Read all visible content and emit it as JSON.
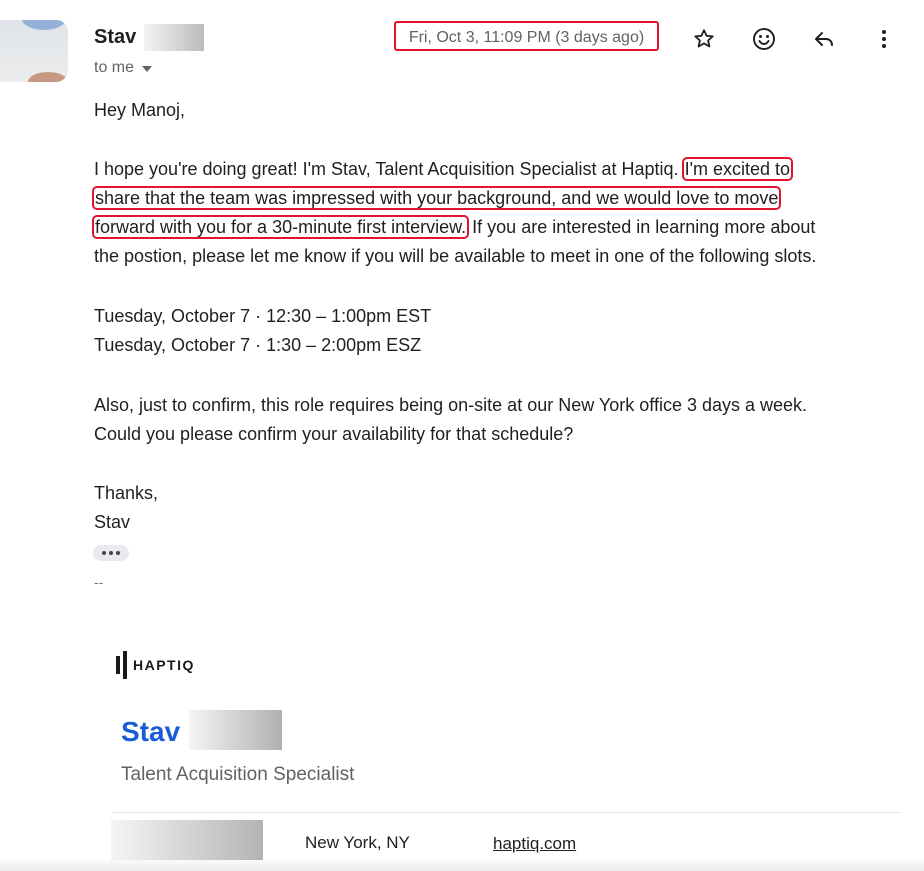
{
  "header": {
    "sender_name": "Stav",
    "recipient_label": "to me",
    "date": "Fri, Oct 3, 11:09 PM (3 days ago)",
    "icons": [
      "star-icon",
      "emoji-icon",
      "reply-icon",
      "more-vert-icon"
    ]
  },
  "email": {
    "greeting": "Hey Manoj,",
    "para1_line1_pre": "I hope you're doing great! I'm Stav, Talent Acquisition Specialist at Haptiq.",
    "para1_line1_hl": "I'm excited to",
    "para1_line2_hl": "share that the team was impressed with your background, and we would love to move",
    "para1_line3_hl": "forward with you for a 30-minute first interview.",
    "para1_line3_post": "If you are interested in learning more about",
    "para1_line4": "the postion, please let me know if you will be available to meet in one of the following slots.",
    "slot1": "Tuesday, October 7 · 12:30 – 1:00pm EST",
    "slot2": "Tuesday, October 7 · 1:30 – 2:00pm ESZ",
    "para3_line1": "Also, just to confirm, this role requires being on-site at our New York office 3 days a week.",
    "para3_line2": "Could you please confirm your availability for that schedule?",
    "closing": "Thanks,",
    "closing_name": "Stav",
    "sig_separator": "--"
  },
  "signature": {
    "logo_text": "HAPTIQ",
    "name": "Stav",
    "title": "Talent Acquisition Specialist",
    "location": "New York, NY",
    "website": "haptiq.com"
  },
  "colors": {
    "highlight_border": "#e0142c",
    "signature_name": "#1a5bd8"
  }
}
